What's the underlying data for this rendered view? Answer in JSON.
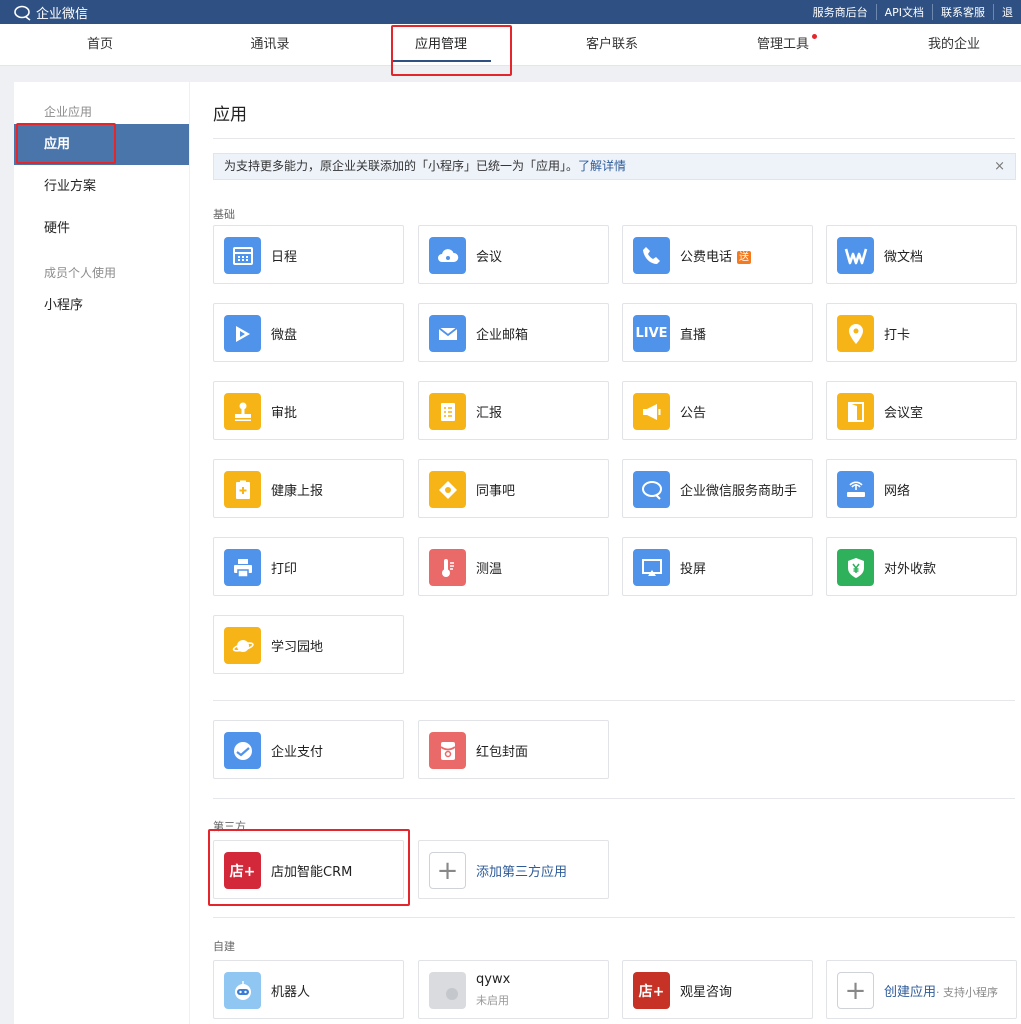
{
  "topbar": {
    "brand": "企业微信",
    "links": [
      "服务商后台",
      "API文档",
      "联系客服",
      "退"
    ]
  },
  "nav": {
    "tabs": [
      "首页",
      "通讯录",
      "应用管理",
      "客户联系",
      "管理工具",
      "我的企业"
    ],
    "active": "应用管理"
  },
  "sidebar": {
    "group1": "企业应用",
    "items1": [
      "应用",
      "行业方案",
      "硬件"
    ],
    "group2": "成员个人使用",
    "items2": [
      "小程序"
    ]
  },
  "main": {
    "title": "应用",
    "notice": "为支持更多能力，原企业关联添加的「小程序」已统一为「应用」。",
    "notice_link": "了解详情",
    "notice_close": "×",
    "section_basic": "基础",
    "basic_apps": [
      "日程",
      "会议",
      "公费电话",
      "微文档",
      "微盘",
      "企业邮箱",
      "直播",
      "打卡",
      "审批",
      "汇报",
      "公告",
      "会议室",
      "健康上报",
      "同事吧",
      "企业微信服务商助手",
      "网络",
      "打印",
      "测温",
      "投屏",
      "对外收款",
      "学习园地"
    ],
    "phone_badge": "送",
    "live_icon_text": "LIVE",
    "pay_apps": [
      "企业支付",
      "红包封面"
    ],
    "section_third": "第三方",
    "third_apps": [
      "店加智能CRM"
    ],
    "add_third": "添加第三方应用",
    "section_self": "自建",
    "self_apps": [
      "机器人",
      "qywx",
      "观星咨询"
    ],
    "qywx_status": "未启用",
    "create_app": "创建应用",
    "create_app_sub": "· 支持小程序",
    "logo_glyph": "店+"
  },
  "colors": {
    "topbar": "#2e5082",
    "accent": "#4a75aa",
    "highlight": "#e3262b",
    "blue_icon": "#4f93ea",
    "yellow_icon": "#f6b417",
    "green_icon": "#2fb15c",
    "red_icon": "#ea6a6a",
    "crm_icon": "#d2283a"
  }
}
